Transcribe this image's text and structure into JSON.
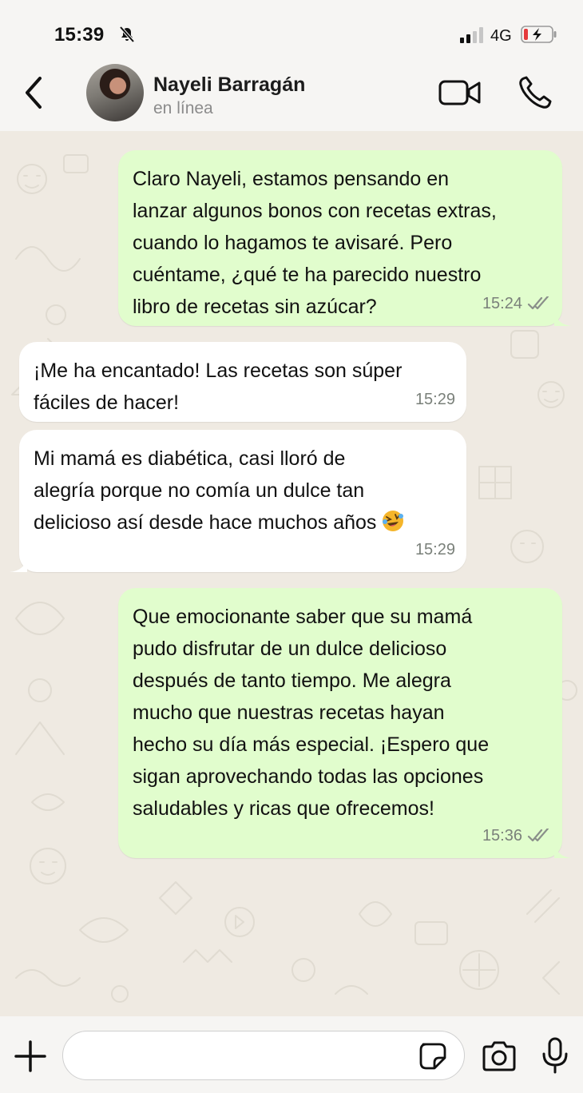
{
  "status_bar": {
    "time": "15:39",
    "network": "4G",
    "icons": [
      "bell-slash-icon",
      "signal-icon",
      "battery-charging-icon"
    ]
  },
  "header": {
    "contact_name": "Nayeli Barragán",
    "contact_status": "en línea",
    "icons": [
      "chevron-left-icon",
      "video-camera-icon",
      "phone-icon"
    ]
  },
  "messages": [
    {
      "direction": "outgoing",
      "lines": [
        "Claro Nayeli, estamos pensando en",
        "lanzar algunos bonos con recetas extras,",
        "cuando lo hagamos te avisaré. Pero",
        "cuéntame, ¿qué te ha parecido nuestro",
        "libro de recetas sin azúcar?"
      ],
      "time": "15:24",
      "status": "read"
    },
    {
      "direction": "incoming",
      "lines": [
        "¡Me ha encantado! Las recetas son súper",
        "fáciles de hacer!"
      ],
      "time": "15:29"
    },
    {
      "direction": "incoming",
      "lines": [
        "Mi mamá es diabética, casi lloró de",
        "alegría porque no comía un dulce tan",
        "delicioso así desde hace muchos años"
      ],
      "emoji": "rolling-laughing-emoji",
      "time": "15:29"
    },
    {
      "direction": "outgoing",
      "lines": [
        "Que emocionante saber que su mamá",
        "pudo disfrutar de un dulce delicioso",
        "después de tanto tiempo. Me alegra",
        "mucho que nuestras recetas hayan",
        "hecho su día más especial. ¡Espero que",
        "sigan aprovechando todas las opciones",
        "saludables y ricas que ofrecemos!"
      ],
      "time": "15:36",
      "status": "read"
    }
  ],
  "composer": {
    "input_value": "",
    "icons": [
      "plus-icon",
      "sticker-icon",
      "camera-icon",
      "microphone-icon"
    ]
  },
  "colors": {
    "outgoing_bubble": "#e1fdcd",
    "incoming_bubble": "#ffffff",
    "chat_background": "#efeae2",
    "read_ticks": "#8a8f8a"
  }
}
